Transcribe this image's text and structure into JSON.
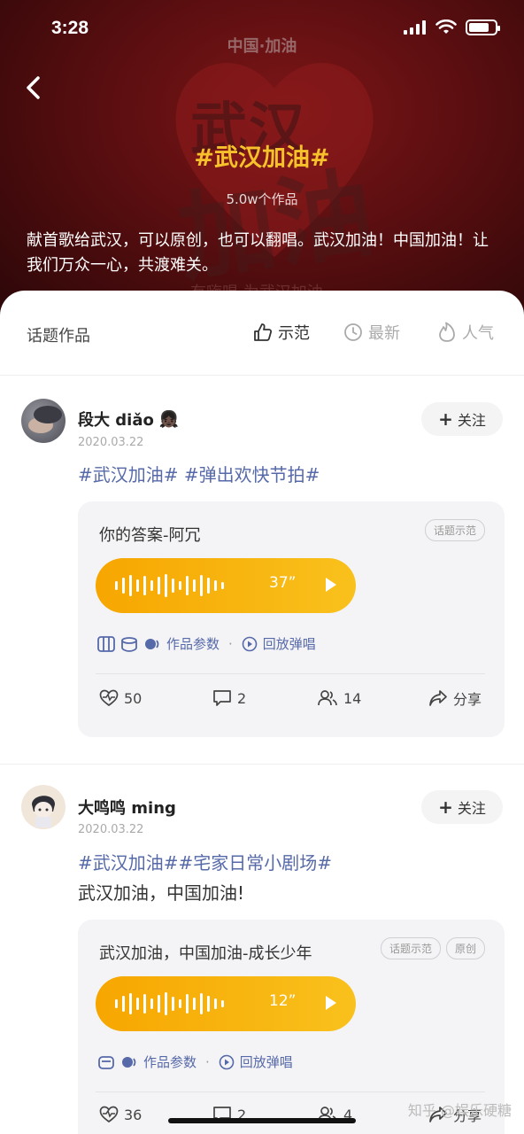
{
  "status_bar": {
    "time": "3:28"
  },
  "header": {
    "bg_brand": "中国·加油",
    "bg_title_1": "武汉",
    "bg_title_2": "加油",
    "bg_small": "有嗨唱   为武汉加油",
    "title": "#武汉加油#",
    "count": "5.0w个作品",
    "description": "献首歌给武汉，可以原创，也可以翻唱。武汉加油！中国加油！让我们万众一心，共渡难关。"
  },
  "tabs": {
    "section_title": "话题作品",
    "items": [
      {
        "label": "示范",
        "icon": "thumb-up-icon",
        "active": true
      },
      {
        "label": "最新",
        "icon": "clock-icon",
        "active": false
      },
      {
        "label": "人气",
        "icon": "flame-icon",
        "active": false
      }
    ]
  },
  "posts": [
    {
      "author": "段大 diǎo",
      "emoji": "👧🏿",
      "date": "2020.03.22",
      "follow_label": "关注",
      "tags": "#武汉加油# #弹出欢快节拍#",
      "text": "",
      "song": "你的答案-阿冗",
      "badges": [
        "话题示范"
      ],
      "duration": "37”",
      "params_label": "作品参数",
      "replay_label": "回放弹唱",
      "likes": "50",
      "comments": "2",
      "duets": "14",
      "share_label": "分享"
    },
    {
      "author": "大鸣鸣 ming",
      "emoji": "",
      "date": "2020.03.22",
      "follow_label": "关注",
      "tags": "#武汉加油##宅家日常小剧场#",
      "text": "武汉加油，中国加油!",
      "song": "武汉加油，中国加油-成长少年",
      "badges": [
        "话题示范",
        "原创"
      ],
      "duration": "12”",
      "params_label": "作品参数",
      "replay_label": "回放弹唱",
      "likes": "36",
      "comments": "2",
      "duets": "4",
      "share_label": "分享"
    }
  ],
  "watermark": "知乎 @娱乐硬糖",
  "colors": {
    "accent_yellow": "#f6c12a",
    "tag_blue": "#5669a8",
    "player_orange": "#f7a600",
    "header_red": "#5a0e10"
  }
}
